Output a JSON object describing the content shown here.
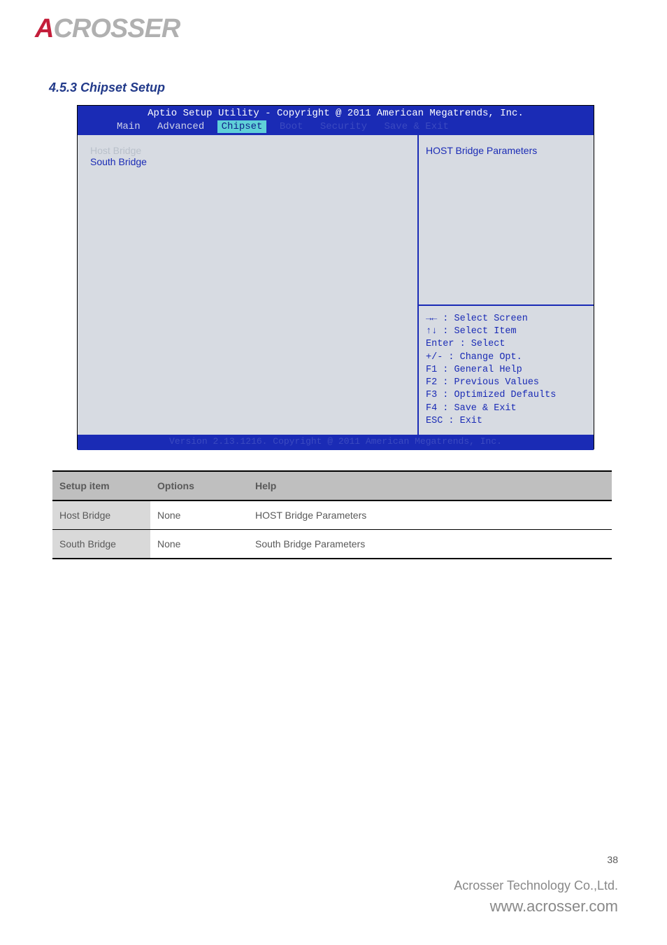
{
  "logo": {
    "text": "CROSSER",
    "first_letter": "A"
  },
  "section_heading": "4.5.3  Chipset Setup",
  "bios": {
    "title": "Aptio Setup Utility - Copyright @ 2011 American Megatrends, Inc.",
    "tabs": [
      "Main",
      "Advanced",
      "Chipset",
      "Boot",
      "Security",
      "Save & Exit"
    ],
    "active_tab_index": 2,
    "left_items": [
      "Host Bridge",
      "South Bridge"
    ],
    "right_top": "HOST Bridge Parameters",
    "help_lines": [
      "→← : Select Screen",
      "↑↓ : Select Item",
      "Enter : Select",
      "+/- : Change Opt.",
      "F1 : General Help",
      "F2 : Previous Values",
      "F3 : Optimized Defaults",
      "F4 : Save & Exit",
      "ESC : Exit"
    ],
    "footer": "Version 2.13.1216. Copyright @ 2011 American Megatrends, Inc."
  },
  "table": {
    "headers": [
      "Setup item",
      "Options",
      "Help"
    ],
    "rows": [
      {
        "item": "Host Bridge",
        "options": "None",
        "help": "HOST Bridge Parameters"
      },
      {
        "item": "South Bridge",
        "options": "None",
        "help": "South Bridge Parameters"
      }
    ]
  },
  "page_number": "38",
  "footer_company": "Acrosser Technology Co.,Ltd.",
  "footer_url": "www.acrosser.com"
}
